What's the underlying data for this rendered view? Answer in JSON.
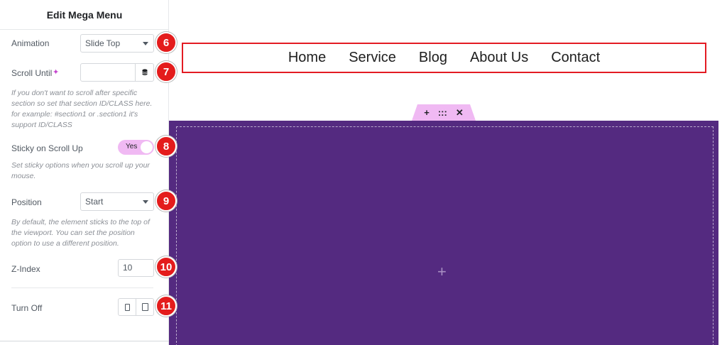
{
  "panel": {
    "title": "Edit Mega Menu",
    "animation": {
      "label": "Animation",
      "value": "Slide Top"
    },
    "scroll_until": {
      "label": "Scroll Until",
      "value": "",
      "hint": "If you don't want to scroll after specific section so set that section ID/CLASS here. for example: #section1 or .section1 it's support ID/CLASS"
    },
    "sticky_scroll_up": {
      "label": "Sticky on Scroll Up",
      "toggle": "Yes",
      "hint": "Set sticky options when you scroll up your mouse."
    },
    "position": {
      "label": "Position",
      "value": "Start",
      "hint": "By default, the element sticks to the top of the viewport. You can set the position option to use a different position."
    },
    "z_index": {
      "label": "Z-Index",
      "value": "10"
    },
    "turn_off": {
      "label": "Turn Off"
    }
  },
  "badges": [
    "6",
    "7",
    "8",
    "9",
    "10",
    "11"
  ],
  "menu": {
    "items": [
      "Home",
      "Service",
      "Blog",
      "About Us",
      "Contact"
    ]
  },
  "section_handle": {
    "add": "+",
    "move": ":::",
    "close": "✕"
  },
  "canvas": {
    "add_plus": "+"
  },
  "colors": {
    "accent_pink": "#f0b9f3",
    "badge_red": "#e41c1c",
    "section_purple": "#542a80",
    "menu_border": "#e31b23"
  }
}
